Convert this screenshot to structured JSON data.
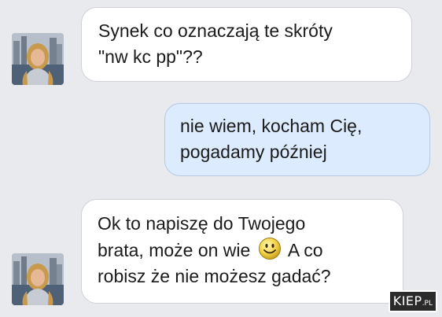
{
  "messages": [
    {
      "from": "received",
      "avatar_icon": "user-photo-icon",
      "lines": [
        "Synek co oznaczają te skróty",
        "\"nw kc pp\"??"
      ]
    },
    {
      "from": "sent",
      "lines": [
        "nie wiem, kocham Cię,",
        "pogadamy później"
      ]
    },
    {
      "from": "received",
      "avatar_icon": "user-photo-icon",
      "lines": [
        "Ok to napiszę do Twojego",
        "brata, może on wie",
        "A co",
        "robisz że nie możesz gadać?"
      ],
      "emoji": "smiley-icon"
    }
  ],
  "watermark": {
    "brand": "KIEP",
    "suffix": ".PL"
  },
  "colors": {
    "background": "#e9eaed",
    "received_bubble": "#ffffff",
    "sent_bubble": "#dcebfd"
  }
}
